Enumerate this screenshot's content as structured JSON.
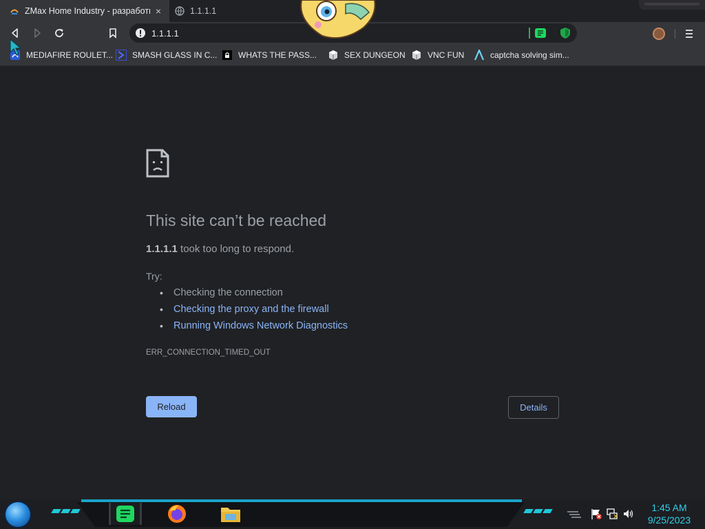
{
  "tabs": [
    {
      "title": "ZMax Home Industry - разработк",
      "active": true,
      "close": "×"
    },
    {
      "title": "1.1.1.1",
      "active": false
    }
  ],
  "toolbar": {
    "url": "1.1.1.1",
    "back_icon": "back-arrow-icon",
    "forward_icon": "forward-arrow-icon",
    "reload_icon": "reload-icon",
    "menu_icon": "kebab-menu-icon"
  },
  "bookmarks": [
    {
      "label": "MEDIAFIRE ROULET...",
      "icon": "mediafire-icon"
    },
    {
      "label": "SMASH GLASS IN C...",
      "icon": "chevron-icon"
    },
    {
      "label": "WHATS THE PASS...",
      "icon": "lock-icon"
    },
    {
      "label": "SEX DUNGEON",
      "icon": "cube-icon"
    },
    {
      "label": "VNC FUN",
      "icon": "cube-icon"
    },
    {
      "label": "captcha solving sim...",
      "icon": "arrow-logo-icon"
    }
  ],
  "error": {
    "title": "This site can’t be reached",
    "host": "1.1.1.1",
    "summary_rest": " took too long to respond.",
    "try_label": "Try:",
    "suggestions": [
      {
        "text": "Checking the connection",
        "link": false
      },
      {
        "text": "Checking the proxy and the firewall",
        "link": true
      },
      {
        "text": "Running Windows Network Diagnostics",
        "link": true
      }
    ],
    "code": "ERR_CONNECTION_TIMED_OUT",
    "reload_label": "Reload",
    "details_label": "Details"
  },
  "taskbar": {
    "apps": [
      "spotify-icon",
      "firefox-icon",
      "file-explorer-icon"
    ],
    "clock_time": "1:45 AM",
    "clock_date": "9/25/2023"
  },
  "colors": {
    "page_bg": "#202124",
    "link": "#8ab4f8",
    "toolbar": "#35363a",
    "clock": "#2fd0ea"
  }
}
